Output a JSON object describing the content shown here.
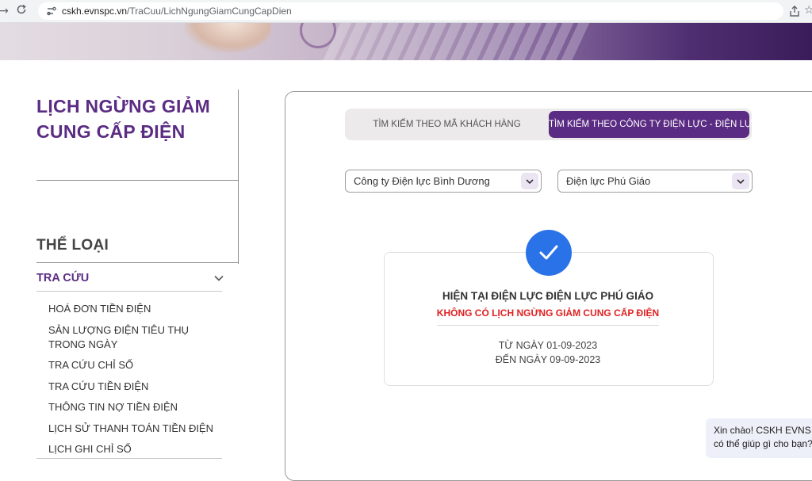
{
  "browser": {
    "url_host": "cskh.evnspc.vn",
    "url_path": "/TraCuu/LichNgungGiamCungCapDien"
  },
  "sidebar": {
    "title": "LỊCH NGỪNG GIẢM CUNG CẤP ĐIỆN",
    "category_heading": "THỂ LOẠI",
    "section_label": "TRA CỨU",
    "items": [
      "HOÁ ĐƠN TIỀN ĐIỆN",
      "SẢN LƯỢNG ĐIỆN TIÊU THỤ TRONG NGÀY",
      "TRA CỨU CHỈ SỐ",
      "TRA CỨU TIỀN ĐIỆN",
      "THÔNG TIN NỢ TIỀN ĐIỆN",
      "LỊCH SỬ THANH TOÁN TIỀN ĐIỆN",
      "LỊCH GHI CHỈ SỐ"
    ]
  },
  "tabs": {
    "by_customer": "TÌM KIẾM THEO MÃ KHÁCH HÀNG",
    "by_company": "TÌM KIẾM THEO CÔNG TY ĐIỆN LỰC - ĐIỆN LỰC",
    "active": "by_company"
  },
  "filters": {
    "company": "Công ty Điện lực Bình Dương",
    "branch": "Điện lực Phú Giáo"
  },
  "result": {
    "line1": "HIỆN TẠI ĐIỆN LỰC ĐIỆN LỰC PHÚ GIÁO",
    "line2": "KHÔNG CÓ LỊCH NGỪNG GIẢM CUNG CẤP ĐIỆN",
    "from": "TỪ NGÀY 01-09-2023",
    "to": "ĐẾN NGÀY 09-09-2023"
  },
  "chat": {
    "line1": "Xin chào! CSKH EVNS",
    "line2": "có thể giúp gì cho bạn?"
  },
  "colors": {
    "brand_purple": "#5b2c83",
    "alert_red": "#e02020",
    "check_blue": "#2a72e8"
  }
}
